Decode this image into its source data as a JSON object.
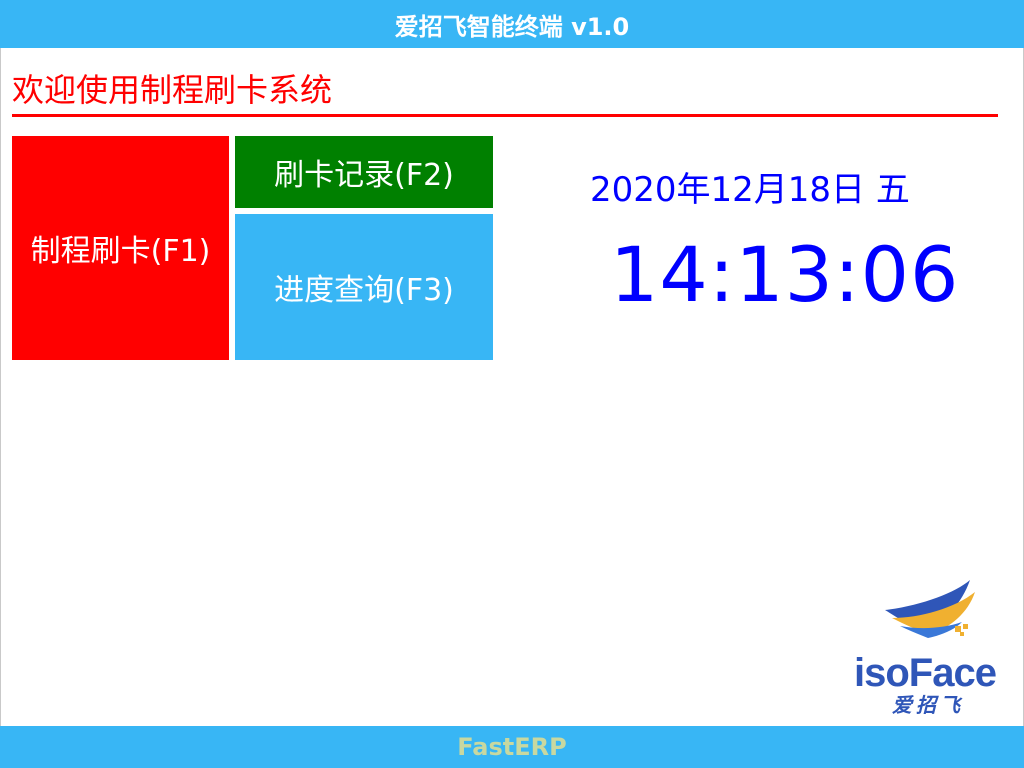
{
  "window": {
    "title": "爱招飞智能终端 v1.0"
  },
  "main": {
    "welcome": "欢迎使用制程刷卡系统",
    "buttons": {
      "f1": "制程刷卡(F1)",
      "f2": "刷卡记录(F2)",
      "f3": "进度查询(F3)"
    },
    "date": "2020年12月18日 五",
    "time": "14:13:06"
  },
  "logo": {
    "text_en": "isoFace",
    "text_cn": "爱招飞"
  },
  "footer": {
    "text": "FastERP"
  },
  "colors": {
    "bar": "#38b6f5",
    "red": "#ff0000",
    "green": "#008000",
    "clock": "#0000ff"
  }
}
